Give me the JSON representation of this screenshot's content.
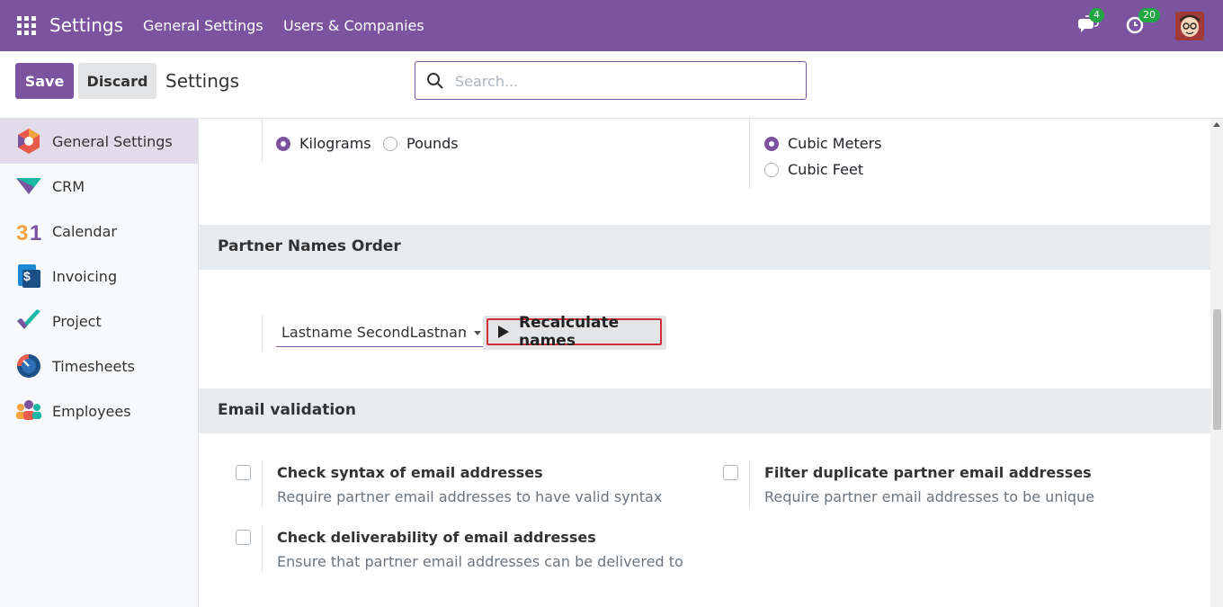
{
  "navbar": {
    "brand": "Settings",
    "menu": [
      "General Settings",
      "Users & Companies"
    ],
    "messages_badge": "4",
    "activities_badge": "20"
  },
  "control_panel": {
    "save_label": "Save",
    "discard_label": "Discard",
    "title": "Settings",
    "search_placeholder": "Search..."
  },
  "sidebar": {
    "items": [
      {
        "label": "General Settings",
        "icon": "general-settings-icon",
        "active": true
      },
      {
        "label": "CRM",
        "icon": "crm-icon"
      },
      {
        "label": "Calendar",
        "icon": "calendar-icon"
      },
      {
        "label": "Invoicing",
        "icon": "invoicing-icon"
      },
      {
        "label": "Project",
        "icon": "project-icon"
      },
      {
        "label": "Timesheets",
        "icon": "timesheets-icon"
      },
      {
        "label": "Employees",
        "icon": "employees-icon"
      }
    ]
  },
  "units": {
    "weight": {
      "options": [
        "Kilograms",
        "Pounds"
      ],
      "selected": "Kilograms"
    },
    "volume": {
      "options": [
        "Cubic Meters",
        "Cubic Feet"
      ],
      "selected": "Cubic Meters"
    }
  },
  "partner_names": {
    "section_title": "Partner Names Order",
    "select_value": "Lastname SecondLastname Firstname",
    "recalc_label": "Recalculate names"
  },
  "email_validation": {
    "section_title": "Email validation",
    "options": [
      {
        "title": "Check syntax of email addresses",
        "desc": "Require partner email addresses to have valid syntax",
        "checked": false
      },
      {
        "title": "Filter duplicate partner email addresses",
        "desc": "Require partner email addresses to be unique",
        "checked": false
      },
      {
        "title": "Check deliverability of email addresses",
        "desc": "Ensure that partner email addresses can be delivered to",
        "checked": false
      }
    ]
  },
  "colors": {
    "brand": "#7b539e",
    "badge": "#22a745",
    "highlight": "#d0303a"
  }
}
